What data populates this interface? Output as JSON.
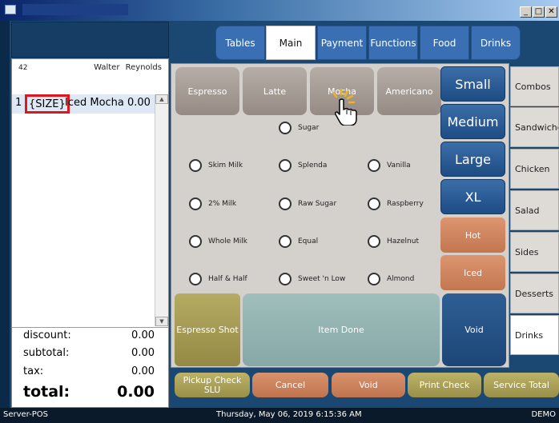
{
  "window": {
    "minimize": "_",
    "maximize": "□",
    "close": "✕"
  },
  "check": {
    "number": "42",
    "server": "Walter Reynolds",
    "items": [
      {
        "qty": "1",
        "size": "{SIZE}",
        "name": "Iced Mocha",
        "price": "0.00"
      }
    ],
    "scroll_up": "▲",
    "scroll_down": "▼"
  },
  "totals": {
    "discount_label": "discount:",
    "discount": "0.00",
    "subtotal_label": "subtotal:",
    "subtotal": "0.00",
    "tax_label": "tax:",
    "tax": "0.00",
    "total_label": "total:",
    "total": "0.00"
  },
  "tabs": [
    "Tables",
    "Main",
    "Payment",
    "Functions",
    "Food",
    "Drinks"
  ],
  "drinks": [
    "Espresso",
    "Latte",
    "Mocha",
    "Americano"
  ],
  "options": {
    "sugar": "Sugar",
    "skim_milk": "Skim Milk",
    "splenda": "Splenda",
    "vanilla": "Vanilla",
    "two_milk": "2% Milk",
    "raw_sugar": "Raw Sugar",
    "raspberry": "Raspberry",
    "whole_milk": "Whole Milk",
    "equal": "Equal",
    "hazelnut": "Hazelnut",
    "half_half": "Half & Half",
    "sweet_n_low": "Sweet 'n Low",
    "almond": "Almond"
  },
  "sizes": [
    "Small",
    "Medium",
    "Large",
    "XL"
  ],
  "temps": [
    "Hot",
    "Iced"
  ],
  "actions": {
    "espresso_shot": "Espresso Shot",
    "item_done": "Item Done",
    "void": "Void"
  },
  "categories": [
    "Combos",
    "Sandwiches",
    "Chicken",
    "Salad",
    "Sides",
    "Desserts",
    "Drinks"
  ],
  "bottom": {
    "pickup": "Pickup Check SLU",
    "cancel": "Cancel",
    "void": "Void",
    "print": "Print Check",
    "service_total": "Service Total"
  },
  "status": {
    "left": "Server-POS",
    "center": "Thursday, May 06, 2019 6:15:36 AM",
    "right": "DEMO"
  },
  "colors": {
    "highlight": "#e0161c",
    "tab_active": "#ffffff",
    "size_blue": "#1e4c84",
    "temp_orange": "#c27750"
  }
}
